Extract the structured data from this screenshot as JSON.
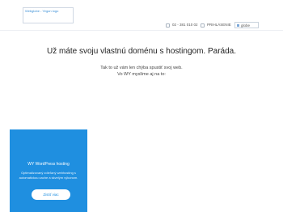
{
  "header": {
    "logo_alt": "Webglobe - Yegon logo",
    "phone": "02 - 381 010 02",
    "login": "PRIHLÁSENIE",
    "language": "globe"
  },
  "main": {
    "headline": "Už máte svoju vlastnú doménu s hostingom. Paráda.",
    "line1": "Tak to už vám len chýba spustiť svoj web.",
    "line2": "Vo WY myslíme aj na to:"
  },
  "promo": {
    "title": "WY WordPress hosting",
    "text": "Optimalizovaný zdieľaný webhosting s automatickou cache a skvelým výkonom.",
    "button": "Zistiť viac",
    "color": "#1f8fe0"
  }
}
